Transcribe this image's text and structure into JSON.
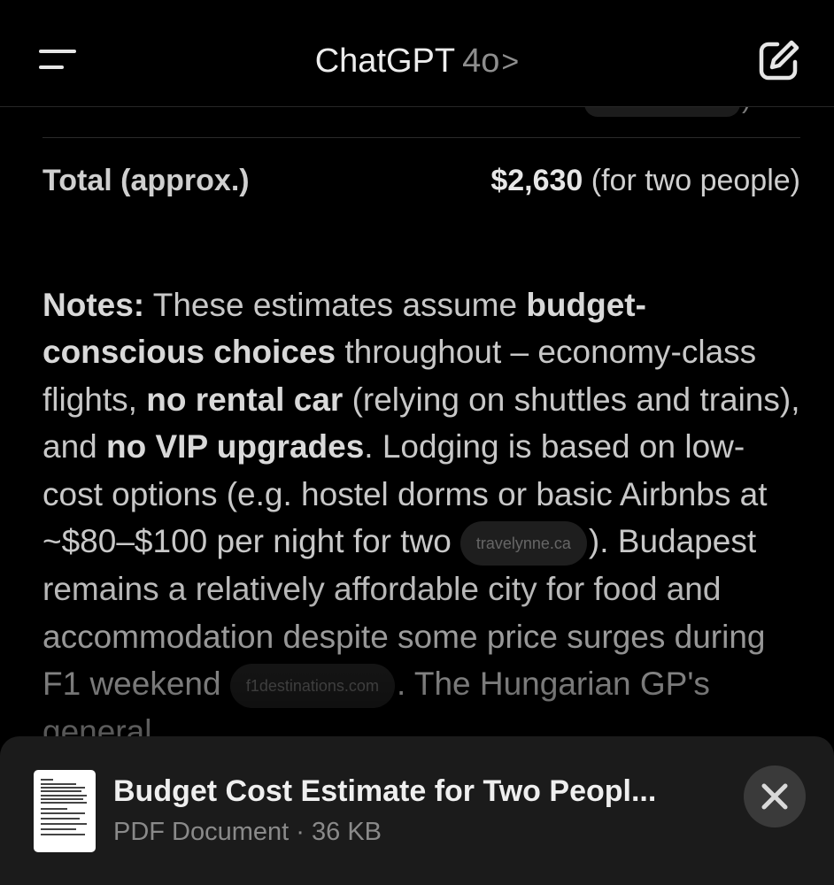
{
  "header": {
    "title": "ChatGPT",
    "model": "4o",
    "chevron": ">",
    "menu_icon": "hamburger-menu-icon",
    "edit_icon": "new-chat-edit-icon"
  },
  "table": {
    "total_label": "Total (approx.)",
    "total_amount": "$2,630",
    "total_note": "(for two people)"
  },
  "notes": {
    "label": "Notes:",
    "t1": " These estimates assume ",
    "b1": "budget-conscious choices",
    "t2": " throughout – economy-class flights, ",
    "b2": "no rental car",
    "t3": " (relying on shuttles and trains), and ",
    "b3": "no VIP upgrades",
    "t4": ". Lodging is based on low-cost options (e.g. hostel dorms or basic Airbnbs at ~$80–$100 per night for two",
    "cite1": "travelynne.ca",
    "t5": "). Budapest remains a relatively affordable city for food and accommodation despite some price surges during F1 weekend",
    "cite2": "f1destinations.com",
    "t6": ". The Hungarian GP's general"
  },
  "attachment": {
    "title": "Budget Cost Estimate for Two Peopl...",
    "meta": "PDF Document · 36 KB",
    "close_icon": "close-icon",
    "thumbnail": "pdf-thumbnail"
  },
  "colors": {
    "background": "#000000",
    "text": "#c8c8c8",
    "bar": "#1b1b1b",
    "close_button": "#3a3a3a"
  }
}
